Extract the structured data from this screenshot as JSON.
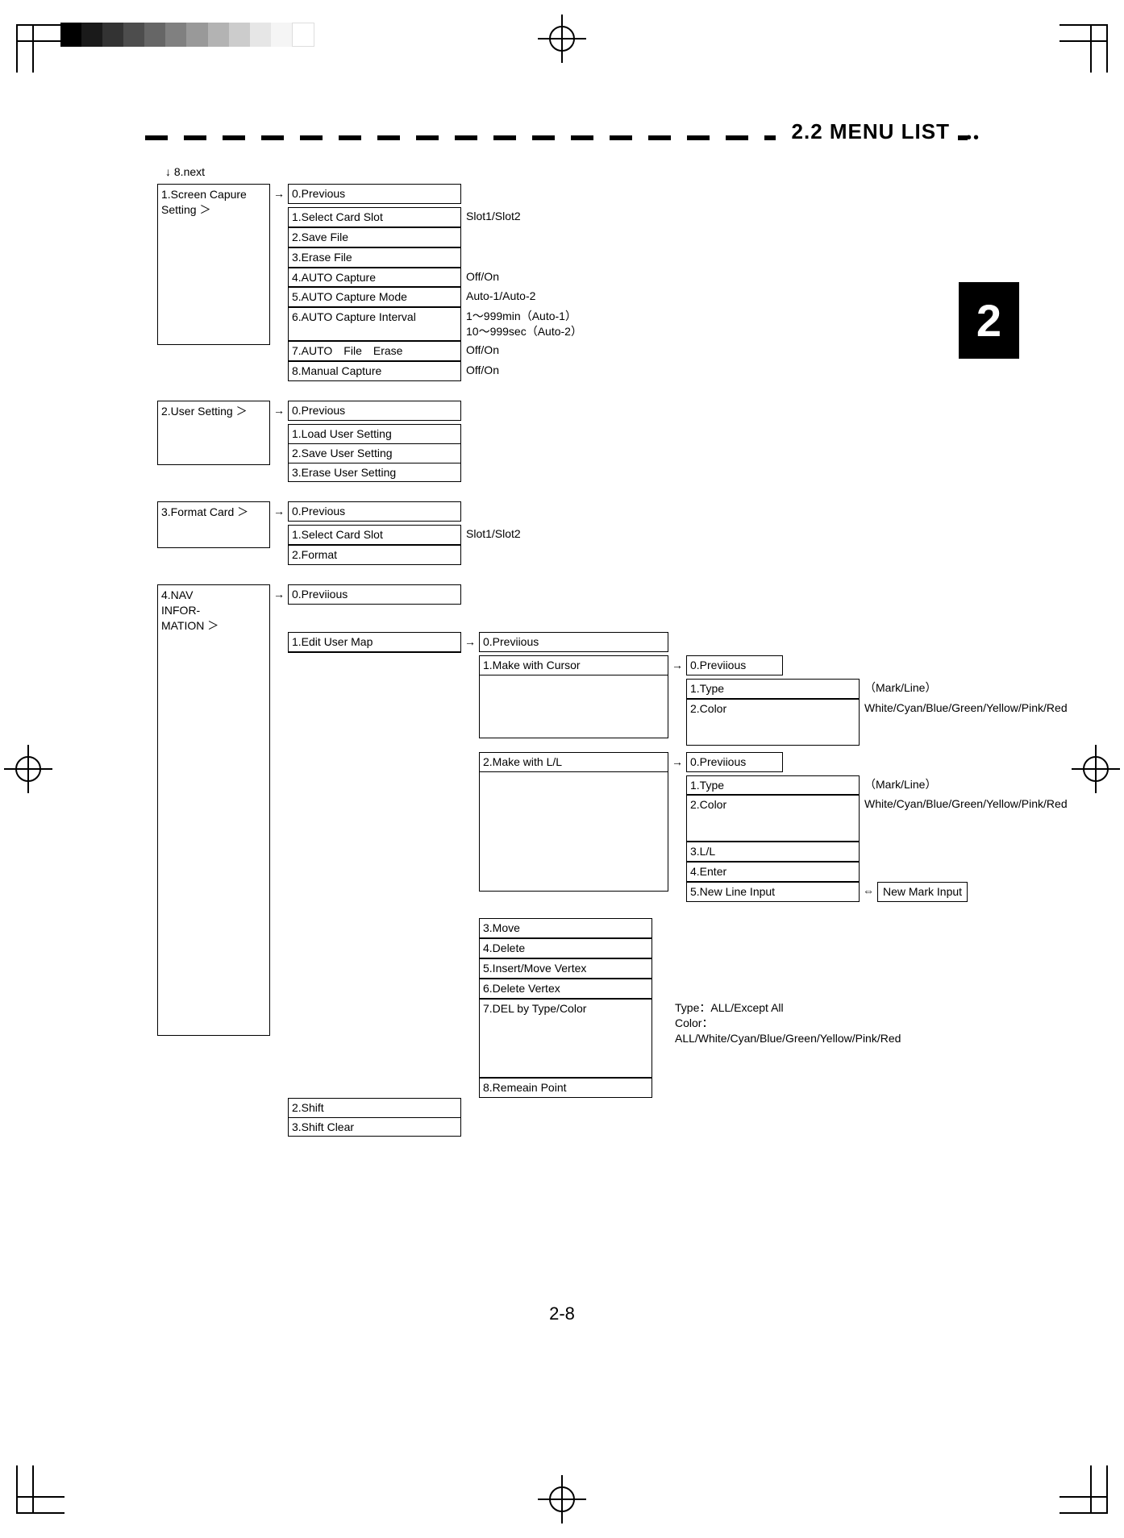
{
  "header": {
    "section_title": "2.2 MENU LIST",
    "chapter_tab": "2"
  },
  "page_number": "2-8",
  "continuation_label": "↓ 8.next",
  "tree": {
    "screen_capture": {
      "parent": "1.Screen Capure Setting  ＞",
      "items": [
        {
          "label": "0.Previous",
          "value": ""
        },
        {
          "label": "1.Select Card Slot",
          "value": "Slot1/Slot2"
        },
        {
          "label": "2.Save File",
          "value": ""
        },
        {
          "label": "3.Erase File",
          "value": ""
        },
        {
          "label": "4.AUTO Capture",
          "value": "Off/On"
        },
        {
          "label": "5.AUTO Capture Mode",
          "value": "Auto-1/Auto-2"
        },
        {
          "label": "6.AUTO Capture Interval",
          "value": "1～999min（Auto-1）\n10～999sec（Auto-2）"
        },
        {
          "label": "7.AUTO　File　Erase",
          "value": "Off/On"
        },
        {
          "label": "8.Manual Capture",
          "value": "Off/On"
        }
      ]
    },
    "user_setting": {
      "parent": "2.User Setting ＞",
      "items": [
        {
          "label": "0.Previous"
        },
        {
          "label": "1.Load User Setting"
        },
        {
          "label": "2.Save User Setting"
        },
        {
          "label": "3.Erase User Setting"
        }
      ]
    },
    "format_card": {
      "parent": "3.Format Card   ＞",
      "items": [
        {
          "label": "0.Previous",
          "value": ""
        },
        {
          "label": "1.Select Card Slot",
          "value": "Slot1/Slot2"
        },
        {
          "label": "2.Format",
          "value": ""
        }
      ]
    },
    "nav_info": {
      "parent": "4.NAV\n INFOR-\n MATION ＞",
      "top": [
        {
          "label": "0.Previious"
        }
      ],
      "edit_user_map": {
        "label": "1.Edit User Map",
        "sub": {
          "prev": "0.Previious",
          "make_cursor": {
            "label": "1.Make with Cursor",
            "leaf": [
              {
                "label": "0.Previious",
                "value": ""
              },
              {
                "label": "1.Type",
                "value": "（Mark/Line）"
              },
              {
                "label": "2.Color",
                "value": "White/Cyan/Blue/Green/Yellow/Pink/Red"
              }
            ]
          },
          "make_ll": {
            "label": "2.Make with L/L",
            "leaf": [
              {
                "label": "0.Previious",
                "value": ""
              },
              {
                "label": "1.Type",
                "value": "（Mark/Line）"
              },
              {
                "label": "2.Color",
                "value": "White/Cyan/Blue/Green/Yellow/Pink/Red"
              },
              {
                "label": "3.L/L",
                "value": ""
              },
              {
                "label": "4.Enter",
                "value": ""
              },
              {
                "label": "5.New Line Input",
                "value": ""
              }
            ],
            "swap_label": "New Mark Input"
          },
          "rest": [
            {
              "label": "3.Move"
            },
            {
              "label": "4.Delete"
            },
            {
              "label": "5.Insert/Move Vertex"
            },
            {
              "label": "6.Delete Vertex"
            },
            {
              "label": "7.DEL by Type/Color",
              "value": "Type：ALL/Except All\nColor：ALL/White/Cyan/Blue/Green/Yellow/Pink/Red"
            },
            {
              "label": "8.Remeain Point"
            }
          ]
        }
      },
      "tail": [
        {
          "label": "2.Shift"
        },
        {
          "label": "3.Shift Clear"
        }
      ]
    }
  }
}
